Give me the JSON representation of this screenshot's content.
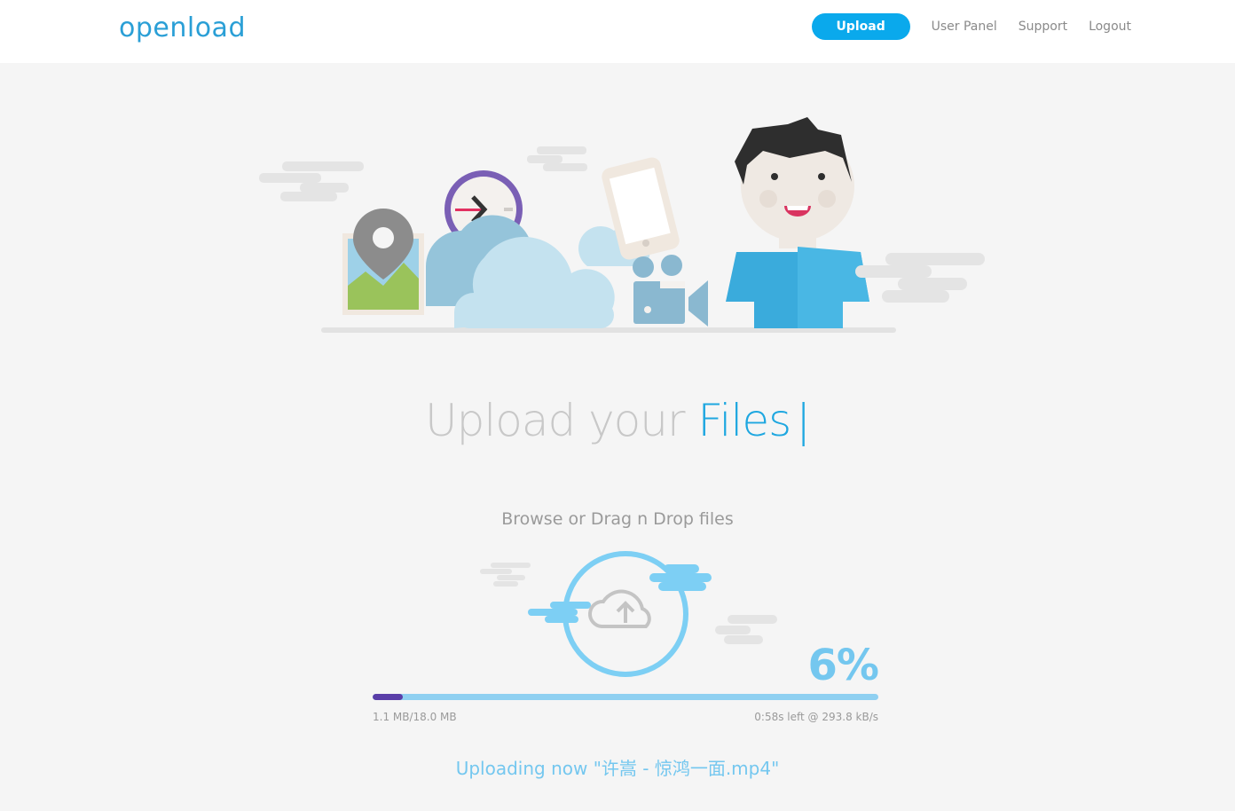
{
  "header": {
    "logo": "openload",
    "nav": {
      "upload": "Upload",
      "user_panel": "User Panel",
      "support": "Support",
      "logout": "Logout"
    }
  },
  "main": {
    "headline_part1": "Upload your",
    "headline_part2": "Files",
    "caret": "|",
    "browse": "Browse or Drag n Drop files",
    "progress": {
      "percent_label": "6%",
      "fraction": 0.06,
      "size": "1.1 MB/18.0 MB",
      "time": "0:58s left @ 293.8 kB/s"
    },
    "uploading_now": "Uploading now \"许嵩 - 惊鸿一面.mp4\""
  },
  "colors": {
    "accent": "#1ea7e0",
    "button": "#0aa9ec",
    "progress_track": "#8fd0f1",
    "progress_fill": "#5a3ea8",
    "percent": "#74c7ef"
  }
}
